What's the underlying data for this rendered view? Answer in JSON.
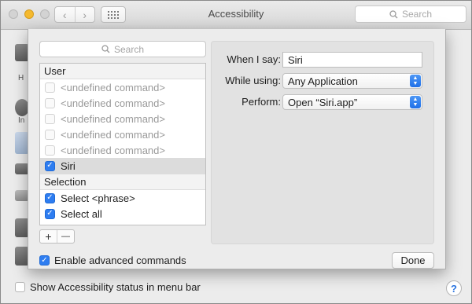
{
  "window": {
    "title": "Accessibility",
    "search_placeholder": "Search",
    "back_icon": "‹",
    "forward_icon": "›"
  },
  "background": {
    "sidebar_labels": [
      "H",
      "In"
    ],
    "status_checkbox_label": "Show Accessibility status in menu bar",
    "status_checkbox_checked": false,
    "help_label": "?"
  },
  "sheet": {
    "search_placeholder": "Search",
    "list": {
      "user_header": "User",
      "user_items": [
        {
          "label": "<undefined command>",
          "checked": false,
          "enabled": false
        },
        {
          "label": "<undefined command>",
          "checked": false,
          "enabled": false
        },
        {
          "label": "<undefined command>",
          "checked": false,
          "enabled": false
        },
        {
          "label": "<undefined command>",
          "checked": false,
          "enabled": false
        },
        {
          "label": "<undefined command>",
          "checked": false,
          "enabled": false
        },
        {
          "label": "Siri",
          "checked": true,
          "enabled": true,
          "selected": true
        }
      ],
      "selection_header": "Selection",
      "selection_items": [
        {
          "label": "Select <phrase>",
          "checked": true
        },
        {
          "label": "Select all",
          "checked": true
        }
      ]
    },
    "add_label": "+",
    "remove_label": "—",
    "detail": {
      "when_label": "When I say:",
      "when_value": "Siri",
      "using_label": "While using:",
      "using_value": "Any Application",
      "perform_label": "Perform:",
      "perform_value": "Open “Siri.app”"
    },
    "enable_label": "Enable advanced commands",
    "enable_checked": true,
    "done_label": "Done"
  },
  "colors": {
    "accent": "#2e7df0",
    "selection_row": "#dcdcdc"
  }
}
